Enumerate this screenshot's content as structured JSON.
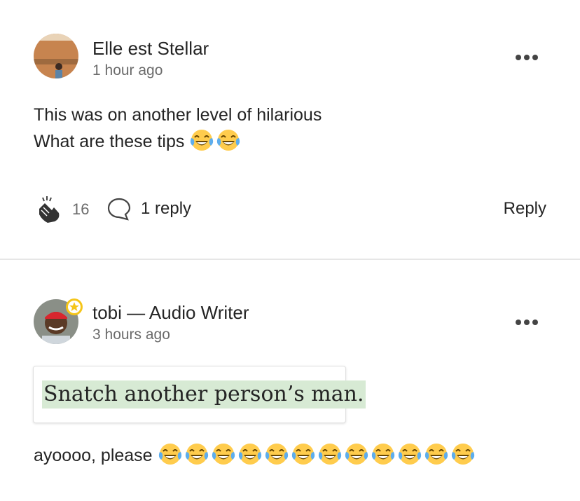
{
  "comments": [
    {
      "author": "Elle est Stellar",
      "time": "1 hour ago",
      "lines": [
        "This was on another level of hilarious",
        "What are these tips"
      ],
      "emoji_after_line2": 2,
      "claps": "16",
      "replies": "1 reply",
      "reply_label": "Reply"
    },
    {
      "author": "tobi — Audio Writer",
      "time": "3 hours ago",
      "quote": "Snatch another person’s man.",
      "text": "ayoooo, please",
      "emoji_after_text": 12
    }
  ],
  "icons": {
    "more": "more-horizontal-icon",
    "clap": "clap-icon",
    "response": "speech-bubble-icon",
    "emoji": "face-with-tears-of-joy-emoji",
    "badge": "member-star-badge-icon"
  },
  "colors": {
    "text": "#242424",
    "muted": "#6b6b6b",
    "highlight": "#d7ead4",
    "badge": "#f5c518"
  }
}
